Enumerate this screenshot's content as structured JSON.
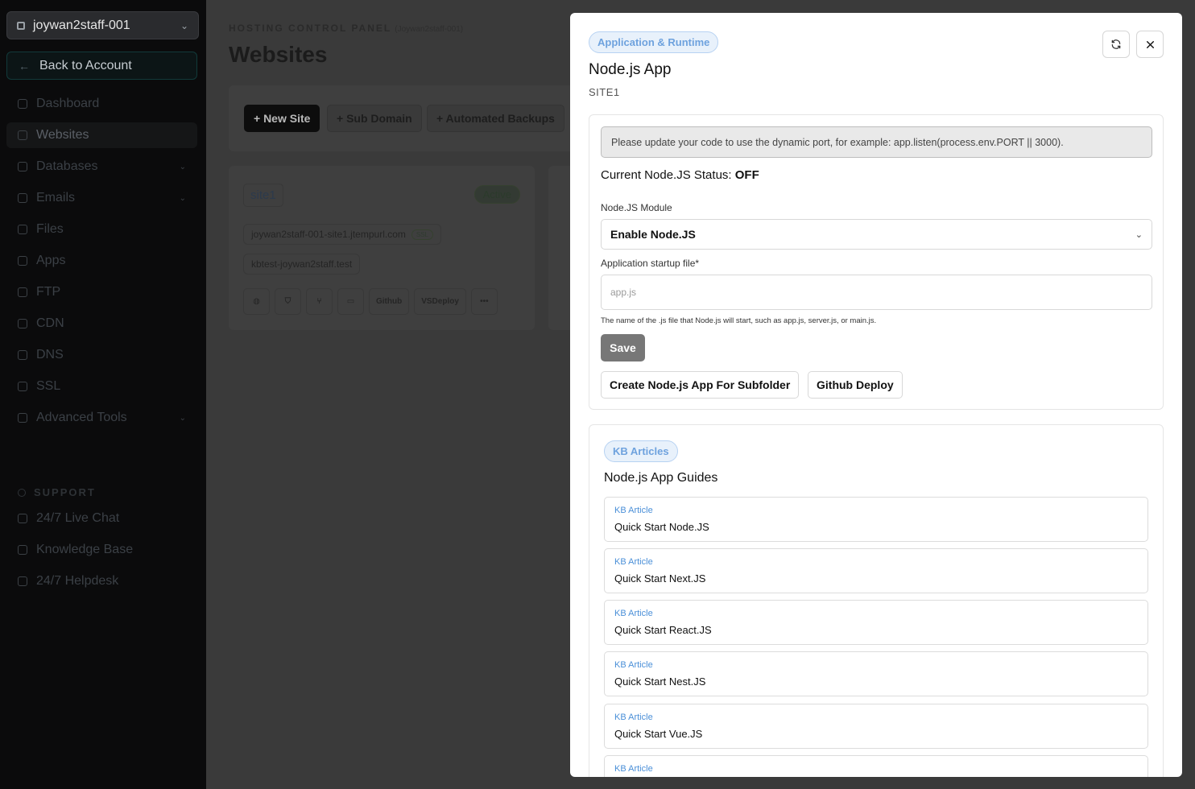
{
  "sidebar": {
    "account": "joywan2staff-001",
    "back": "Back to Account",
    "items": [
      {
        "label": "Dashboard",
        "chevron": false
      },
      {
        "label": "Websites",
        "chevron": false
      },
      {
        "label": "Databases",
        "chevron": true
      },
      {
        "label": "Emails",
        "chevron": true
      },
      {
        "label": "Files",
        "chevron": false
      },
      {
        "label": "Apps",
        "chevron": false
      },
      {
        "label": "FTP",
        "chevron": false
      },
      {
        "label": "CDN",
        "chevron": false
      },
      {
        "label": "DNS",
        "chevron": false
      },
      {
        "label": "SSL",
        "chevron": false
      },
      {
        "label": "Advanced Tools",
        "chevron": true
      }
    ],
    "support_title": "SUPPORT",
    "support_items": [
      "24/7 Live Chat",
      "Knowledge Base",
      "24/7 Helpdesk"
    ]
  },
  "main": {
    "kicker": "HOSTING CONTROL PANEL",
    "kicker_sub": "(Joywan2staff-001)",
    "title": "Websites",
    "toolbar": [
      "+ New Site",
      "+ Sub Domain",
      "+ Automated Backups"
    ],
    "site": {
      "name": "site1",
      "status": "Active",
      "domains": [
        "joywan2staff-001-site1.jtempurl.com",
        "kbtest-joywan2staff.test"
      ],
      "ssl_badge": "SSL",
      "actions": [
        "Github",
        "VSDeploy",
        "•••"
      ]
    }
  },
  "modal": {
    "category": "Application & Runtime",
    "title": "Node.js App",
    "subtitle": "SITE1",
    "notice": "Please update your code to use the dynamic port, for example: app.listen(process.env.PORT || 3000).",
    "status_label": "Current Node.JS Status:",
    "status_value": "OFF",
    "module_label": "Node.JS Module",
    "module_value": "Enable Node.JS",
    "startup_label": "Application startup file*",
    "startup_placeholder": "app.js",
    "startup_help": "The name of the .js file that Node.js will start, such as app.js, server.js, or main.js.",
    "save": "Save",
    "subfolder_button": "Create Node.js App For Subfolder",
    "github_button": "Github Deploy"
  },
  "kb": {
    "pill": "KB Articles",
    "title": "Node.js App Guides",
    "tag": "KB Article",
    "articles": [
      "Quick Start Node.JS",
      "Quick Start Next.JS",
      "Quick Start React.JS",
      "Quick Start Nest.JS",
      "Quick Start Vue.JS",
      ""
    ]
  },
  "colors": {
    "accent_blue": "#4a8fd8",
    "pill_bg": "#e8f1fb",
    "overlay": "#3a3a3a"
  }
}
